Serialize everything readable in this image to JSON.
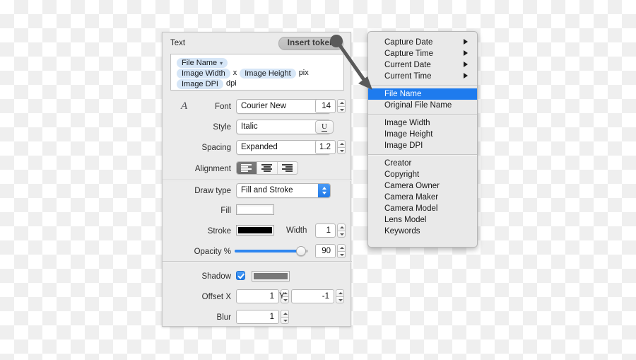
{
  "panel": {
    "title": "Text",
    "insert_token_label": "Insert token",
    "token_field": {
      "lines": [
        [
          {
            "type": "token",
            "label": "File Name",
            "has_caret": true
          }
        ],
        [
          {
            "type": "token",
            "label": "Image Width"
          },
          {
            "type": "text",
            "label": "x"
          },
          {
            "type": "token",
            "label": "Image Height"
          },
          {
            "type": "text",
            "label": "pix"
          }
        ],
        [
          {
            "type": "token",
            "label": "Image DPI"
          },
          {
            "type": "text",
            "label": "dpi"
          }
        ]
      ]
    },
    "font": {
      "icon": "font-glyph-icon",
      "label": "Font",
      "value": "Courier New",
      "size": "14"
    },
    "style": {
      "label": "Style",
      "value": "Italic",
      "underline_label": "U"
    },
    "spacing": {
      "label": "Spacing",
      "value": "Expanded",
      "amount": "1.2"
    },
    "alignment": {
      "label": "Alignment",
      "options": [
        "align-left",
        "align-center",
        "align-right"
      ],
      "selected": "align-left"
    },
    "draw_type": {
      "label": "Draw type",
      "value": "Fill and Stroke"
    },
    "fill": {
      "label": "Fill",
      "color": "#ffffff"
    },
    "stroke": {
      "label": "Stroke",
      "color": "#000000",
      "width_label": "Width",
      "width": "1"
    },
    "opacity": {
      "label": "Opacity %",
      "value": "90",
      "percent": 90
    },
    "shadow": {
      "label": "Shadow",
      "checked": true,
      "color": "#787878",
      "offset_x_label": "Offset X",
      "offset_x": "1",
      "offset_y_label": "Y",
      "offset_y": "-1",
      "blur_label": "Blur",
      "blur": "1"
    }
  },
  "menu": {
    "groups": [
      {
        "items": [
          {
            "label": "Capture Date",
            "submenu": true
          },
          {
            "label": "Capture Time",
            "submenu": true
          },
          {
            "label": "Current Date",
            "submenu": true
          },
          {
            "label": "Current Time",
            "submenu": true
          }
        ]
      },
      {
        "items": [
          {
            "label": "File Name",
            "selected": true
          },
          {
            "label": "Original File Name"
          }
        ]
      },
      {
        "items": [
          {
            "label": "Image Width"
          },
          {
            "label": "Image Height"
          },
          {
            "label": "Image DPI"
          }
        ]
      },
      {
        "items": [
          {
            "label": "Creator"
          },
          {
            "label": "Copyright"
          },
          {
            "label": "Camera Owner"
          },
          {
            "label": "Camera Maker"
          },
          {
            "label": "Camera Model"
          },
          {
            "label": "Lens Model"
          },
          {
            "label": "Keywords"
          }
        ]
      }
    ]
  },
  "colors": {
    "accent": "#1e7bee",
    "panel_bg": "#ebebeb",
    "menu_bg": "#e9e9e9",
    "token_bg": "#d6e6f7",
    "arrow": "#5a5a5a"
  }
}
